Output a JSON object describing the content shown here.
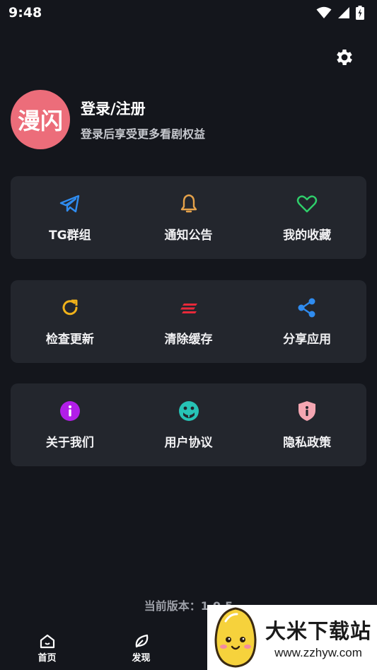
{
  "status_bar": {
    "time": "9:48"
  },
  "profile": {
    "avatar_text": "漫闪",
    "title": "登录/注册",
    "subtitle": "登录后享受更多看剧权益"
  },
  "cards": [
    [
      {
        "label": "TG群组",
        "icon": "telegram-send-icon",
        "color": "#2f8cf0"
      },
      {
        "label": "通知公告",
        "icon": "bell-icon",
        "color": "#e5a24a"
      },
      {
        "label": "我的收藏",
        "icon": "heart-icon",
        "color": "#2fcf6b"
      }
    ],
    [
      {
        "label": "检查更新",
        "icon": "refresh-icon",
        "color": "#f0b21a"
      },
      {
        "label": "清除缓存",
        "icon": "clear-cache-icon",
        "color": "#e8293a"
      },
      {
        "label": "分享应用",
        "icon": "share-icon",
        "color": "#2f8cf0"
      }
    ],
    [
      {
        "label": "关于我们",
        "icon": "info-icon",
        "color": "#b21ee8"
      },
      {
        "label": "用户协议",
        "icon": "agreement-icon",
        "color": "#27c3b6"
      },
      {
        "label": "隐私政策",
        "icon": "privacy-shield-icon",
        "color": "#f4a6b2"
      }
    ]
  ],
  "version_text": "当前版本：1.0.5",
  "bottom_nav": [
    {
      "label": "首页",
      "icon": "home-icon"
    },
    {
      "label": "发现",
      "icon": "leaf-icon"
    }
  ],
  "watermark": {
    "title": "大米下载站",
    "url": "www.zzhyw.com"
  }
}
